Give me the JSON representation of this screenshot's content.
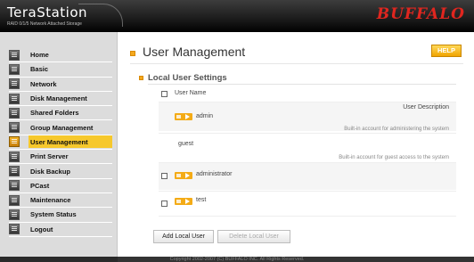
{
  "header": {
    "logo": "TeraStation",
    "subtitle": "RAID 0/1/5 Network Attached Storage",
    "brand": "BUFFALO"
  },
  "sidebar": {
    "items": [
      {
        "label": "Home",
        "icon": "home-icon"
      },
      {
        "label": "Basic",
        "icon": "document-icon"
      },
      {
        "label": "Network",
        "icon": "network-icon"
      },
      {
        "label": "Disk Management",
        "icon": "disk-icon"
      },
      {
        "label": "Shared Folders",
        "icon": "folder-icon"
      },
      {
        "label": "Group Management",
        "icon": "group-icon"
      },
      {
        "label": "User Management",
        "icon": "user-icon",
        "active": true
      },
      {
        "label": "Print Server",
        "icon": "printer-icon"
      },
      {
        "label": "Disk Backup",
        "icon": "backup-icon"
      },
      {
        "label": "PCast",
        "icon": "pcast-icon"
      },
      {
        "label": "Maintenance",
        "icon": "maintenance-icon"
      },
      {
        "label": "System Status",
        "icon": "status-icon"
      },
      {
        "label": "Logout",
        "icon": "logout-icon"
      }
    ]
  },
  "main": {
    "title": "User Management",
    "help_label": "HELP",
    "section_title": "Local User Settings",
    "table": {
      "col_user_name": "User Name",
      "col_user_description": "User Description",
      "rows": [
        {
          "name": "admin",
          "description": "Built-in account for administering the system",
          "checkbox": false,
          "editable": true
        },
        {
          "name": "guest",
          "description": "Built-in account for guest access to the system",
          "checkbox": false,
          "editable": false
        },
        {
          "name": "administrator",
          "description": "",
          "checkbox": true,
          "editable": true
        },
        {
          "name": "test",
          "description": "",
          "checkbox": true,
          "editable": true
        }
      ]
    },
    "add_button": "Add Local User",
    "delete_button": "Delete Local User"
  },
  "footer": {
    "copyright": "Copyright 2002-2007 (C) BUFFALO INC. All Rights Reserved."
  },
  "colors": {
    "accent": "#f4a81d",
    "active_nav": "#f6c82c",
    "brand_red": "#e0261f"
  }
}
